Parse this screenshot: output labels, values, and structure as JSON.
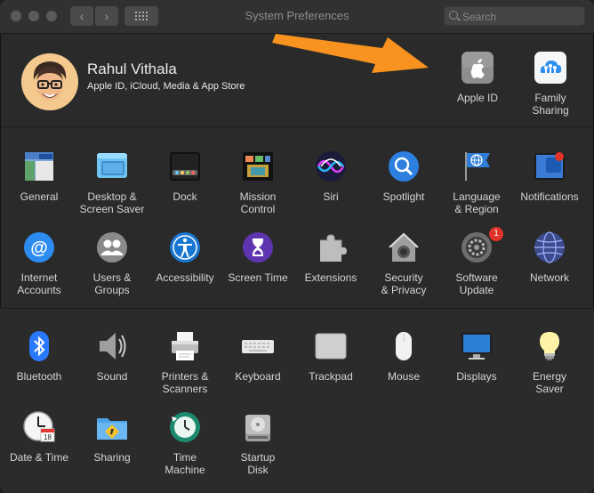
{
  "window": {
    "title": "System Preferences"
  },
  "toolbar": {
    "back_icon": "chevron-left-icon",
    "forward_icon": "chevron-right-icon",
    "grid_icon": "grid-icon",
    "search_placeholder": "Search"
  },
  "account": {
    "name": "Rahul Vithala",
    "subtitle": "Apple ID, iCloud, Media & App Store",
    "items": [
      {
        "label": "Apple ID",
        "icon": "apple-id-icon"
      },
      {
        "label": "Family\nSharing",
        "icon": "family-sharing-icon"
      }
    ]
  },
  "panes": [
    {
      "label": "General",
      "icon": "general-icon"
    },
    {
      "label": "Desktop &\nScreen Saver",
      "icon": "desktop-icon"
    },
    {
      "label": "Dock",
      "icon": "dock-icon"
    },
    {
      "label": "Mission\nControl",
      "icon": "mission-control-icon"
    },
    {
      "label": "Siri",
      "icon": "siri-icon"
    },
    {
      "label": "Spotlight",
      "icon": "spotlight-icon"
    },
    {
      "label": "Language\n& Region",
      "icon": "language-icon"
    },
    {
      "label": "Notifications",
      "icon": "notifications-icon"
    },
    {
      "label": "Internet\nAccounts",
      "icon": "internet-accounts-icon"
    },
    {
      "label": "Users &\nGroups",
      "icon": "users-icon"
    },
    {
      "label": "Accessibility",
      "icon": "accessibility-icon"
    },
    {
      "label": "Screen Time",
      "icon": "screen-time-icon"
    },
    {
      "label": "Extensions",
      "icon": "extensions-icon"
    },
    {
      "label": "Security\n& Privacy",
      "icon": "security-icon"
    },
    {
      "label": "Software\nUpdate",
      "icon": "software-update-icon",
      "badge": "1"
    },
    {
      "label": "Network",
      "icon": "network-icon"
    },
    {
      "label": "Bluetooth",
      "icon": "bluetooth-icon"
    },
    {
      "label": "Sound",
      "icon": "sound-icon"
    },
    {
      "label": "Printers &\nScanners",
      "icon": "printer-icon"
    },
    {
      "label": "Keyboard",
      "icon": "keyboard-icon"
    },
    {
      "label": "Trackpad",
      "icon": "trackpad-icon"
    },
    {
      "label": "Mouse",
      "icon": "mouse-icon"
    },
    {
      "label": "Displays",
      "icon": "displays-icon"
    },
    {
      "label": "Energy\nSaver",
      "icon": "energy-saver-icon"
    },
    {
      "label": "Date & Time",
      "icon": "date-time-icon"
    },
    {
      "label": "Sharing",
      "icon": "sharing-icon"
    },
    {
      "label": "Time\nMachine",
      "icon": "time-machine-icon"
    },
    {
      "label": "Startup\nDisk",
      "icon": "startup-disk-icon"
    }
  ],
  "colors": {
    "window_bg": "#2a2a2a",
    "text": "#d4d4d4",
    "arrow": "#f7931e",
    "badge": "#e0332a"
  }
}
